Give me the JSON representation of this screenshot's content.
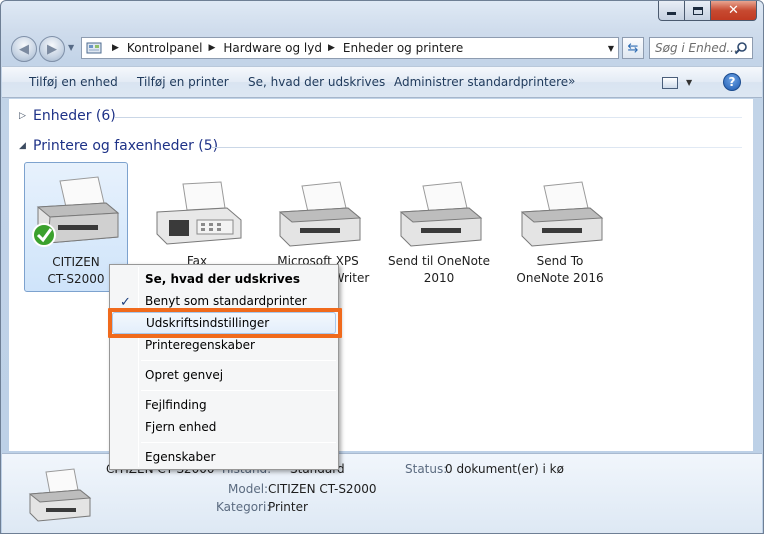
{
  "window": {
    "caption_buttons": [
      "minimize",
      "maximize",
      "close"
    ]
  },
  "address_bar": {
    "crumbs": [
      "Kontrolpanel",
      "Hardware og lyd",
      "Enheder og printere"
    ],
    "search_placeholder": "Søg i Enhed..."
  },
  "toolbar": {
    "items": [
      "Tilføj en enhed",
      "Tilføj en printer",
      "Se, hvad der udskrives",
      "Administrer standardprintere"
    ],
    "more": "»"
  },
  "groups": {
    "devices": "Enheder (6)",
    "printers": "Printere og faxenheder (5)"
  },
  "printers": [
    {
      "name_line1": "CITIZEN",
      "name_line2": "CT-S2000",
      "default": true
    },
    {
      "name_line1": "Fax",
      "name_line2": ""
    },
    {
      "name_line1": "Microsoft XPS",
      "name_line2": "Document Writer"
    },
    {
      "name_line1": "Send til OneNote",
      "name_line2": "2010"
    },
    {
      "name_line1": "Send To",
      "name_line2": "OneNote 2016"
    }
  ],
  "details": {
    "name": "CITIZEN CT-S2000",
    "status_key": "Tilstand:",
    "status_val": "Standard",
    "model_key": "Model:",
    "model_val": "CITIZEN CT-S2000",
    "category_key": "Kategori:",
    "category_val": "Printer",
    "queue_key": "Status:",
    "queue_val": "0 dokument(er) i kø"
  },
  "context_menu": {
    "items": [
      {
        "label": "Se, hvad der udskrives",
        "bold": true
      },
      {
        "label": "Benyt som standardprinter",
        "checked": true
      },
      {
        "label": "Udskriftsindstillinger",
        "highlighted": true
      },
      {
        "label": "Printeregenskaber"
      },
      {
        "label": "Opret genvej"
      },
      {
        "label": "Fejlfinding"
      },
      {
        "label": "Fjern enhed"
      },
      {
        "label": "Egenskaber"
      }
    ]
  },
  "colors": {
    "highlight_box": "#f06a1c",
    "group_heading": "#1e3287",
    "selection": "#cfe4fa"
  }
}
